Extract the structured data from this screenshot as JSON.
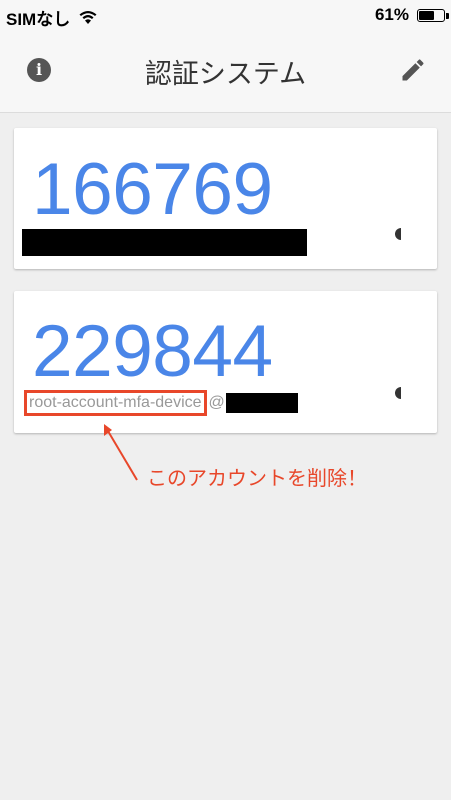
{
  "status_bar": {
    "carrier": "SIMなし",
    "battery": "61%",
    "battery_level": 0.61
  },
  "app_bar": {
    "title": "認証システム",
    "info_icon": "info-icon",
    "edit_icon": "pencil-icon"
  },
  "accounts": [
    {
      "code": "166769",
      "account_label": ""
    },
    {
      "code": "229844",
      "account_label": "root-account-mfa-device",
      "at_sign": "@"
    }
  ],
  "annotation": {
    "text": "このアカウントを削除！",
    "color": "#e8472a"
  },
  "colors": {
    "code_blue": "#4a86e8",
    "highlight_red": "#e8472a",
    "background": "#efefef"
  }
}
